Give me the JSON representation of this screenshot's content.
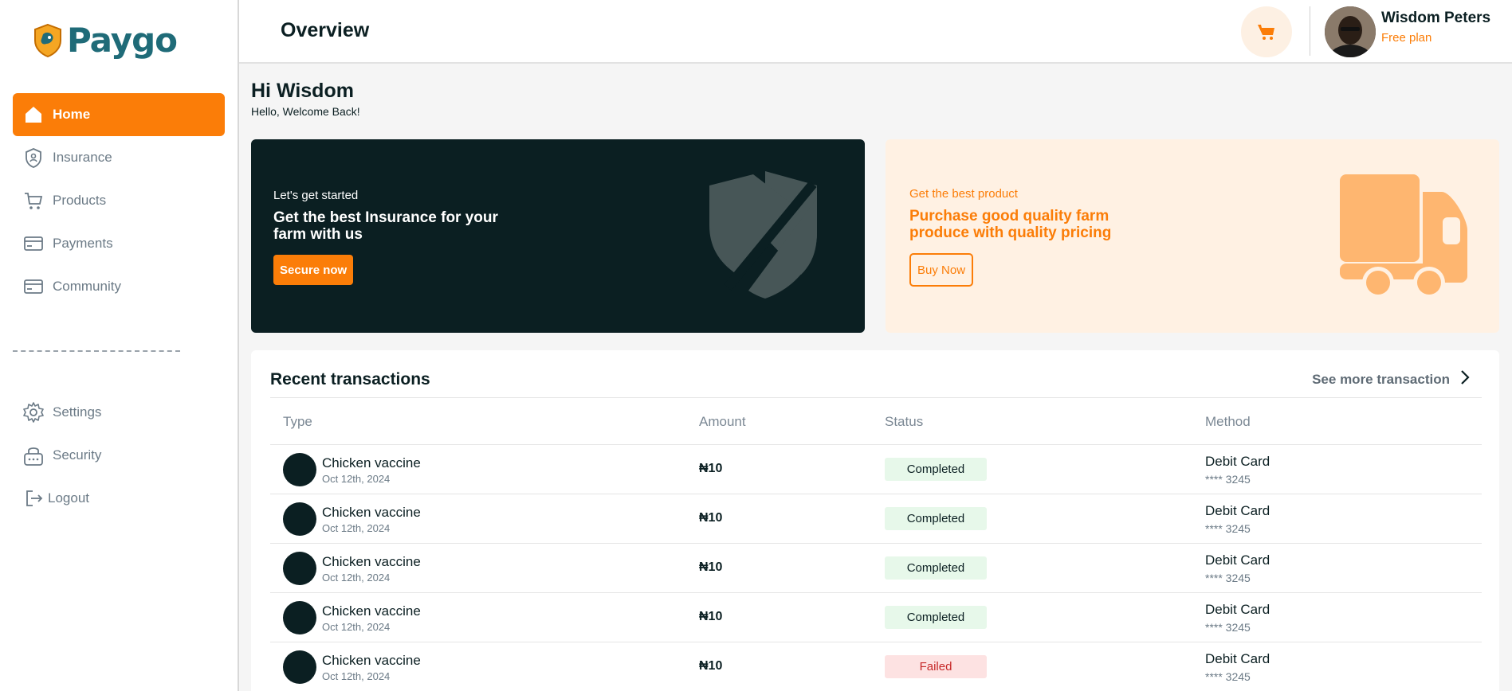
{
  "app": {
    "name": "Paygo",
    "accent": "#fb7d08",
    "dark": "#0b1f22"
  },
  "sidebar": {
    "items": [
      {
        "label": "Home",
        "icon": "home-icon",
        "active": true
      },
      {
        "label": "Insurance",
        "icon": "shield-icon",
        "active": false
      },
      {
        "label": "Products",
        "icon": "cart-icon",
        "active": false
      },
      {
        "label": "Payments",
        "icon": "card-icon",
        "active": false
      },
      {
        "label": "Community",
        "icon": "card-icon",
        "active": false
      }
    ],
    "bottom_items": [
      {
        "label": "Settings",
        "icon": "gear-icon"
      },
      {
        "label": "Security",
        "icon": "lock-icon"
      },
      {
        "label": "Logout",
        "icon": "logout-icon"
      }
    ]
  },
  "header": {
    "title": "Overview",
    "cart_icon": "cart-icon",
    "user": {
      "name": "Wisdom Peters",
      "plan": "Free plan"
    }
  },
  "greeting": {
    "title": "Hi Wisdom",
    "subtitle": "Hello, Welcome Back!"
  },
  "promo_insurance": {
    "kicker": "Let's get started",
    "headline": "Get the best Insurance for your farm with us",
    "cta": "Secure now",
    "icon": "shield-icon"
  },
  "promo_product": {
    "kicker": "Get the best product",
    "headline": "Purchase good quality farm produce with quality pricing",
    "cta": "Buy Now",
    "icon": "truck-icon"
  },
  "transactions": {
    "title": "Recent transactions",
    "see_more": "See more transaction",
    "columns": [
      "Type",
      "Amount",
      "Status",
      "Method"
    ],
    "rows": [
      {
        "name": "Chicken vaccine",
        "date": "Oct 12th, 2024",
        "amount": "₦10",
        "status": "Completed",
        "method": "Debit Card",
        "card": "**** 3245"
      },
      {
        "name": "Chicken vaccine",
        "date": "Oct 12th, 2024",
        "amount": "₦10",
        "status": "Completed",
        "method": "Debit Card",
        "card": "**** 3245"
      },
      {
        "name": "Chicken vaccine",
        "date": "Oct 12th, 2024",
        "amount": "₦10",
        "status": "Completed",
        "method": "Debit Card",
        "card": "**** 3245"
      },
      {
        "name": "Chicken vaccine",
        "date": "Oct 12th, 2024",
        "amount": "₦10",
        "status": "Completed",
        "method": "Debit Card",
        "card": "**** 3245"
      },
      {
        "name": "Chicken vaccine",
        "date": "Oct 12th, 2024",
        "amount": "₦10",
        "status": "Failed",
        "method": "Debit Card",
        "card": "**** 3245"
      }
    ]
  }
}
